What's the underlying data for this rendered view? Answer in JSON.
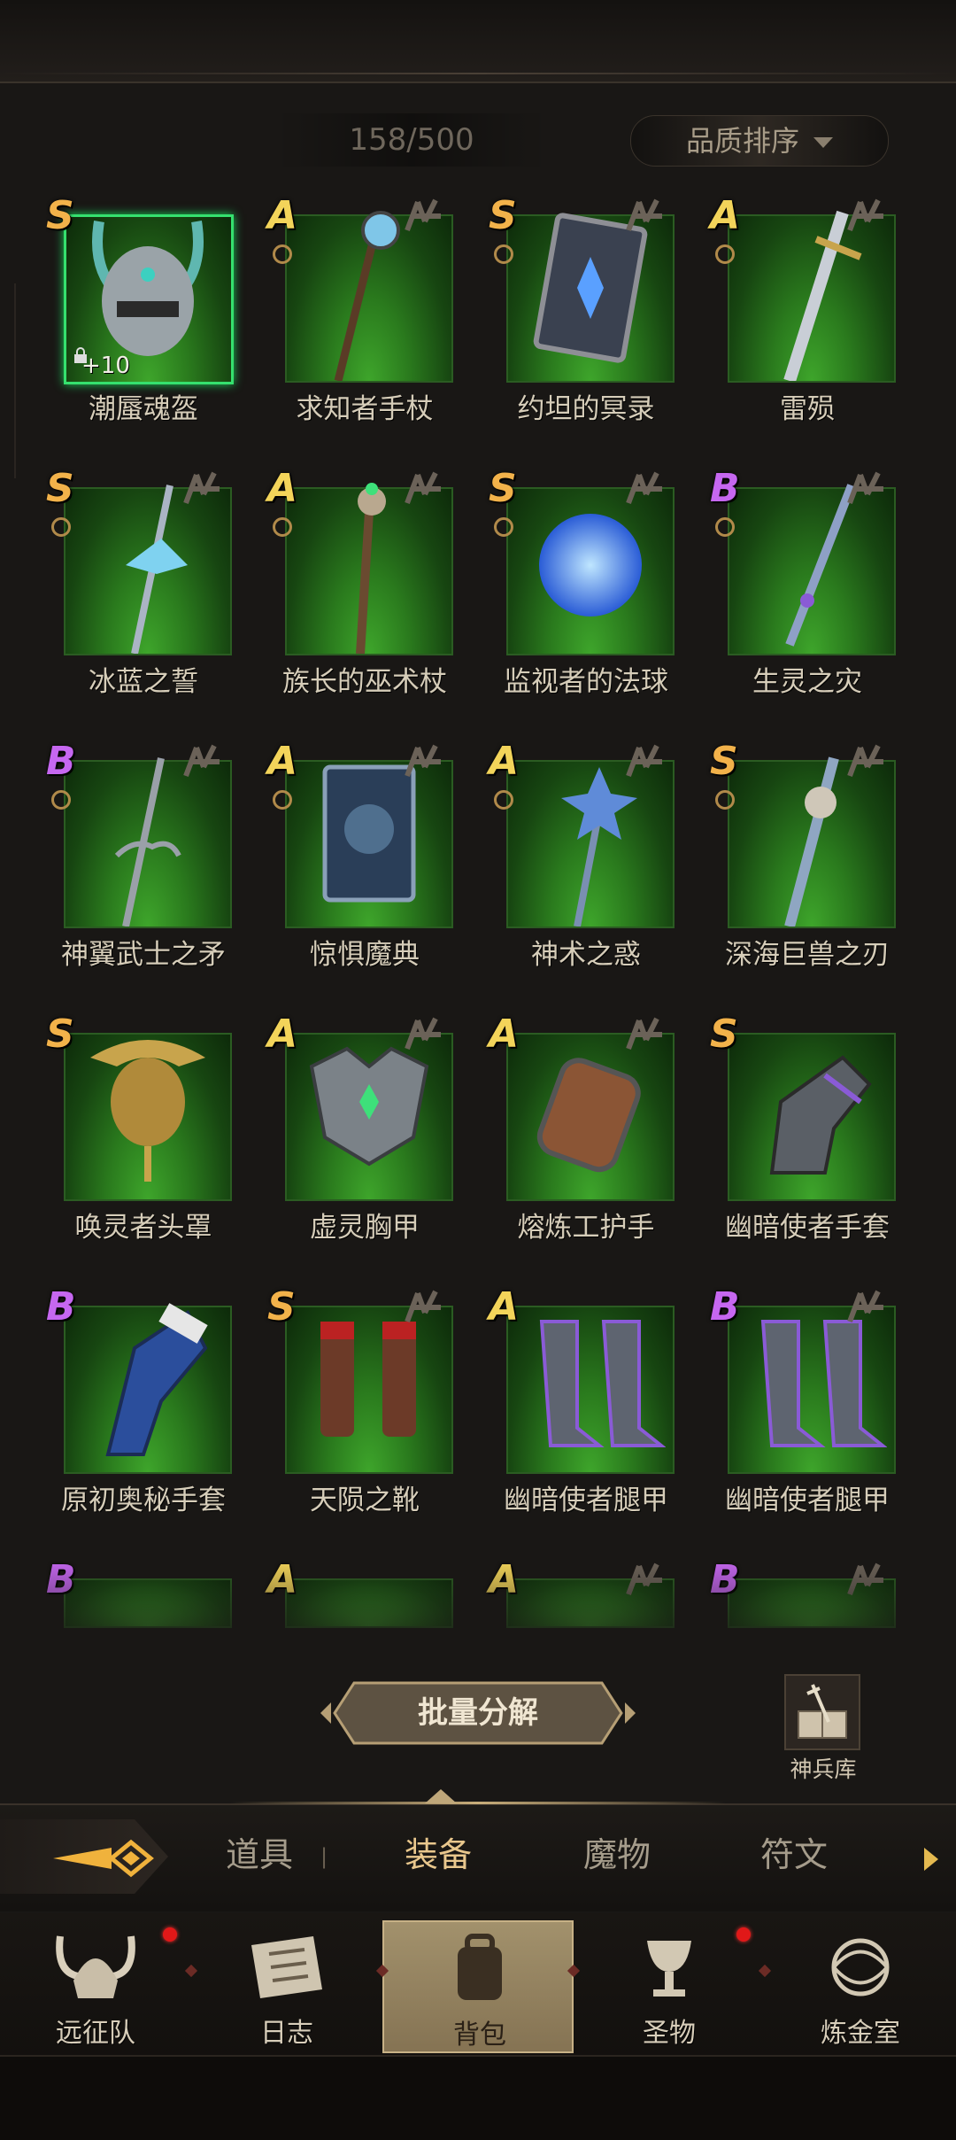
{
  "header": {
    "capacity": "158/500",
    "sort_label": "品质排序"
  },
  "items": [
    {
      "name": "潮蜃魂盔",
      "grade": "S",
      "enhance": "+10",
      "selected": true,
      "ring": false,
      "rune": false,
      "locked": true,
      "icon": "horned-helmet-icon"
    },
    {
      "name": "求知者手杖",
      "grade": "A",
      "enhance": "",
      "selected": false,
      "ring": true,
      "rune": true,
      "locked": false,
      "icon": "orb-staff-icon"
    },
    {
      "name": "约坦的冥录",
      "grade": "S",
      "enhance": "",
      "selected": false,
      "ring": true,
      "rune": true,
      "locked": false,
      "icon": "tome-icon"
    },
    {
      "name": "雷殒",
      "grade": "A",
      "enhance": "",
      "selected": false,
      "ring": true,
      "rune": true,
      "locked": false,
      "icon": "greatsword-icon"
    },
    {
      "name": "冰蓝之誓",
      "grade": "S",
      "enhance": "",
      "selected": false,
      "ring": true,
      "rune": true,
      "locked": false,
      "icon": "ice-spear-icon"
    },
    {
      "name": "族长的巫术杖",
      "grade": "A",
      "enhance": "",
      "selected": false,
      "ring": true,
      "rune": true,
      "locked": false,
      "icon": "shaman-staff-icon"
    },
    {
      "name": "监视者的法球",
      "grade": "S",
      "enhance": "",
      "selected": false,
      "ring": true,
      "rune": true,
      "locked": false,
      "icon": "magic-orb-icon"
    },
    {
      "name": "生灵之灾",
      "grade": "B",
      "enhance": "",
      "selected": false,
      "ring": true,
      "rune": true,
      "locked": false,
      "icon": "dagger-icon"
    },
    {
      "name": "神翼武士之矛",
      "grade": "B",
      "enhance": "",
      "selected": false,
      "ring": true,
      "rune": true,
      "locked": false,
      "icon": "trident-icon"
    },
    {
      "name": "惊惧魔典",
      "grade": "A",
      "enhance": "",
      "selected": false,
      "ring": true,
      "rune": true,
      "locked": false,
      "icon": "grimoire-icon"
    },
    {
      "name": "神术之惑",
      "grade": "A",
      "enhance": "",
      "selected": false,
      "ring": true,
      "rune": true,
      "locked": false,
      "icon": "star-mace-icon"
    },
    {
      "name": "深海巨兽之刃",
      "grade": "S",
      "enhance": "",
      "selected": false,
      "ring": true,
      "rune": true,
      "locked": false,
      "icon": "skull-sword-icon"
    },
    {
      "name": "唤灵者头罩",
      "grade": "S",
      "enhance": "",
      "selected": false,
      "ring": false,
      "rune": false,
      "locked": false,
      "icon": "mask-icon"
    },
    {
      "name": "虚灵胸甲",
      "grade": "A",
      "enhance": "",
      "selected": false,
      "ring": false,
      "rune": true,
      "locked": false,
      "icon": "chestplate-icon"
    },
    {
      "name": "熔炼工护手",
      "grade": "A",
      "enhance": "",
      "selected": false,
      "ring": false,
      "rune": true,
      "locked": false,
      "icon": "bracer-icon"
    },
    {
      "name": "幽暗使者手套",
      "grade": "S",
      "enhance": "",
      "selected": false,
      "ring": false,
      "rune": false,
      "locked": false,
      "icon": "gauntlet-icon"
    },
    {
      "name": "原初奥秘手套",
      "grade": "B",
      "enhance": "",
      "selected": false,
      "ring": false,
      "rune": false,
      "locked": false,
      "icon": "blue-glove-icon"
    },
    {
      "name": "天陨之靴",
      "grade": "S",
      "enhance": "",
      "selected": false,
      "ring": false,
      "rune": true,
      "locked": false,
      "icon": "boots-icon"
    },
    {
      "name": "幽暗使者腿甲",
      "grade": "A",
      "enhance": "",
      "selected": false,
      "ring": false,
      "rune": false,
      "locked": false,
      "icon": "greaves-icon"
    },
    {
      "name": "幽暗使者腿甲",
      "grade": "B",
      "enhance": "",
      "selected": false,
      "ring": false,
      "rune": true,
      "locked": false,
      "icon": "greaves-icon"
    },
    {
      "name": "",
      "grade": "B",
      "enhance": "",
      "selected": false,
      "ring": false,
      "rune": false,
      "locked": false,
      "icon": "item-icon"
    },
    {
      "name": "",
      "grade": "A",
      "enhance": "",
      "selected": false,
      "ring": false,
      "rune": false,
      "locked": false,
      "icon": "item-icon"
    },
    {
      "name": "",
      "grade": "A",
      "enhance": "",
      "selected": false,
      "ring": false,
      "rune": true,
      "locked": false,
      "icon": "item-icon"
    },
    {
      "name": "",
      "grade": "B",
      "enhance": "",
      "selected": false,
      "ring": false,
      "rune": true,
      "locked": false,
      "icon": "item-icon"
    }
  ],
  "actions": {
    "batch_label": "批量分解",
    "armory_label": "神兵库"
  },
  "tabs": [
    {
      "label": "道具",
      "active": false
    },
    {
      "label": "装备",
      "active": true
    },
    {
      "label": "魔物",
      "active": false
    },
    {
      "label": "符文",
      "active": false
    }
  ],
  "nav": [
    {
      "label": "远征队",
      "icon": "viking-helmet-icon",
      "active": false,
      "dot": true
    },
    {
      "label": "日志",
      "icon": "scroll-icon",
      "active": false,
      "dot": false
    },
    {
      "label": "背包",
      "icon": "backpack-icon",
      "active": true,
      "dot": false
    },
    {
      "label": "圣物",
      "icon": "chalice-icon",
      "active": false,
      "dot": true
    },
    {
      "label": "炼金室",
      "icon": "alchemy-icon",
      "active": false,
      "dot": false
    }
  ],
  "colors": {
    "grade_S": "#f2b24a",
    "grade_A": "#f3d45a",
    "grade_B": "#c667f0",
    "selected_border": "#35e06e",
    "slot_green": "#2a7a1d",
    "active_tab": "#e9c78d",
    "notification": "#e11818"
  }
}
